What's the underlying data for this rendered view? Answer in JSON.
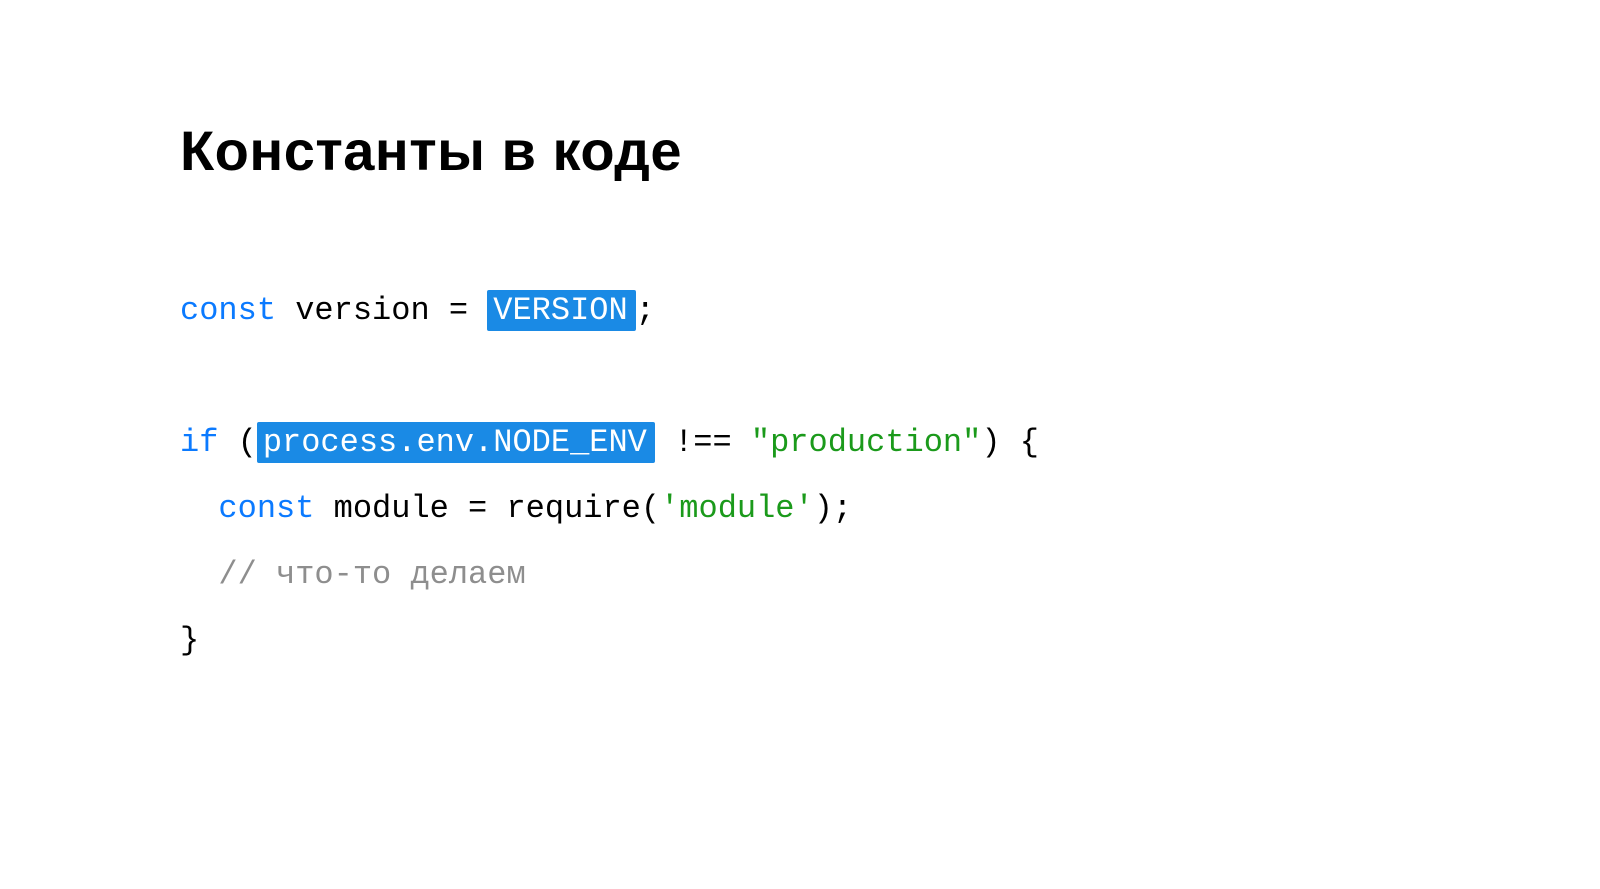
{
  "title": "Константы в коде",
  "code": {
    "l1": {
      "kw": "const",
      "var": " version = ",
      "hl": "VERSION",
      "tail": ";"
    },
    "l2": {
      "kw": "if",
      "head": " (",
      "hl": "process.env.NODE_ENV",
      "mid": " !== ",
      "str": "\"production\"",
      "tail": ") {"
    },
    "l3": {
      "indent": "  ",
      "kw": "const",
      "head": " module = require(",
      "str": "'module'",
      "tail": ");"
    },
    "l4": {
      "indent": "  ",
      "com": "// что-то делаем"
    },
    "l5": {
      "text": "}"
    }
  }
}
